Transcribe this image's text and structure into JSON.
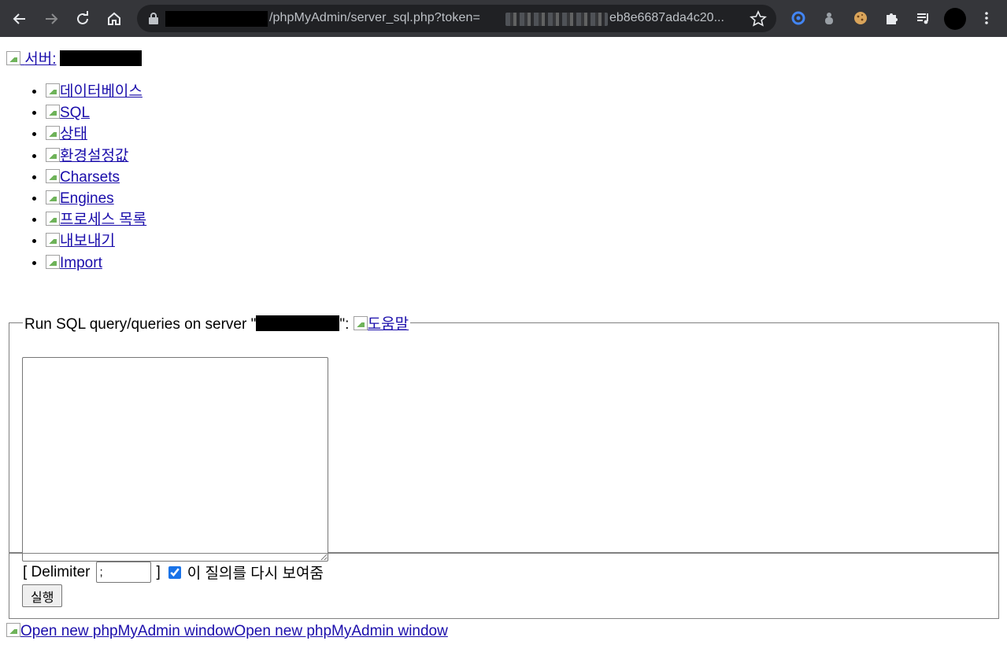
{
  "browser": {
    "url_path": "/phpMyAdmin/server_sql.php?token=",
    "url_tail": "eb8e6687ada4c20..."
  },
  "page": {
    "server_label": "서버:",
    "tabs": [
      {
        "label": "데이터베이스"
      },
      {
        "label": "SQL"
      },
      {
        "label": "상태"
      },
      {
        "label": "환경설정값"
      },
      {
        "label": "Charsets"
      },
      {
        "label": "Engines"
      },
      {
        "label": "프로세스 목록"
      },
      {
        "label": "내보내기"
      },
      {
        "label": "Import"
      }
    ],
    "query": {
      "legend_prefix": "Run SQL query/queries on server \"",
      "legend_suffix": "\":",
      "help_link": "도움말",
      "textarea_value": ""
    },
    "footer": {
      "delimiter_label": "[ Delimiter",
      "delimiter_value": ";",
      "delimiter_close": "]",
      "show_query_label": "이 질의를 다시 보여줌",
      "show_query_checked": true,
      "submit_label": "실행"
    },
    "new_window_link": "Open new phpMyAdmin window",
    "new_window_alt": "Open new phpMyAdmin window"
  }
}
